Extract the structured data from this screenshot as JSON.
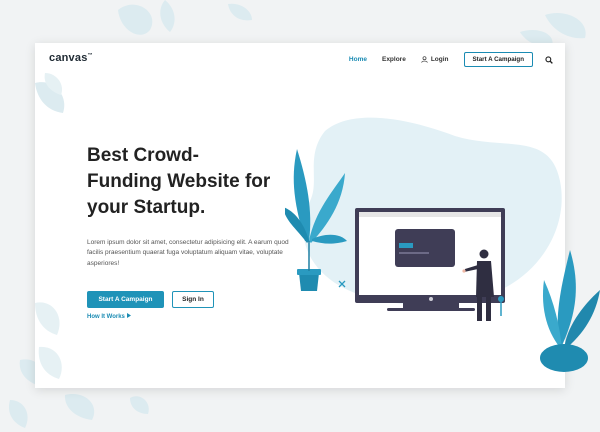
{
  "brand": {
    "logo_text": "canvas",
    "logo_mark": "™",
    "accent_color": "#1a8bb3",
    "leaf_color": "#bfe0ea"
  },
  "nav": {
    "items": [
      {
        "label": "Home",
        "active": true
      },
      {
        "label": "Explore",
        "active": false
      }
    ],
    "login_label": "Login",
    "login_icon": "user-icon",
    "cta_label": "Start A Campaign",
    "search_icon": "search-icon"
  },
  "hero": {
    "title_lines": [
      "Best Crowd-",
      "Funding Website for",
      "your Startup."
    ],
    "description": "Lorem ipsum dolor sit amet, consectetur adipisicing elit. A earum quod facilis praesentium quaerat fuga voluptatum aliquam vitae, voluptate asperiores!",
    "primary_button": "Start A Campaign",
    "secondary_button": "Sign In",
    "link_label": "How It Works",
    "link_icon": "caret-right-icon"
  },
  "illustration": {
    "subject": "person-at-monitor-illustration"
  }
}
